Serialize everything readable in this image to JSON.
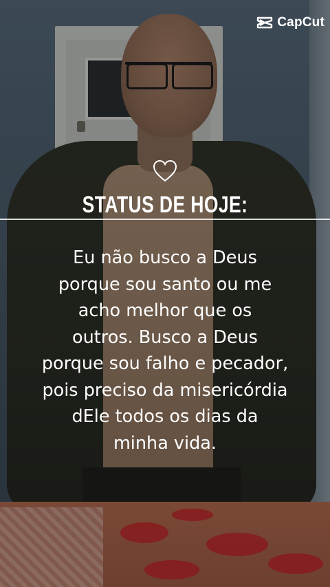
{
  "brand": {
    "name": "CapCut",
    "icon": "capcut-logo-icon"
  },
  "status": {
    "icon": "heart-outline-icon",
    "title": "STATUS DE HOJE:",
    "quote": "Eu não busco a Deus\nporque sou santo ou me\nacho melhor que os\noutros. Busco a Deus\nporque sou falho e pecador,\npois preciso da misericórdia\ndEle todos os dias da\nminha vida."
  },
  "colors": {
    "text": "#ffffff",
    "table_pattern": "#c2272b"
  }
}
